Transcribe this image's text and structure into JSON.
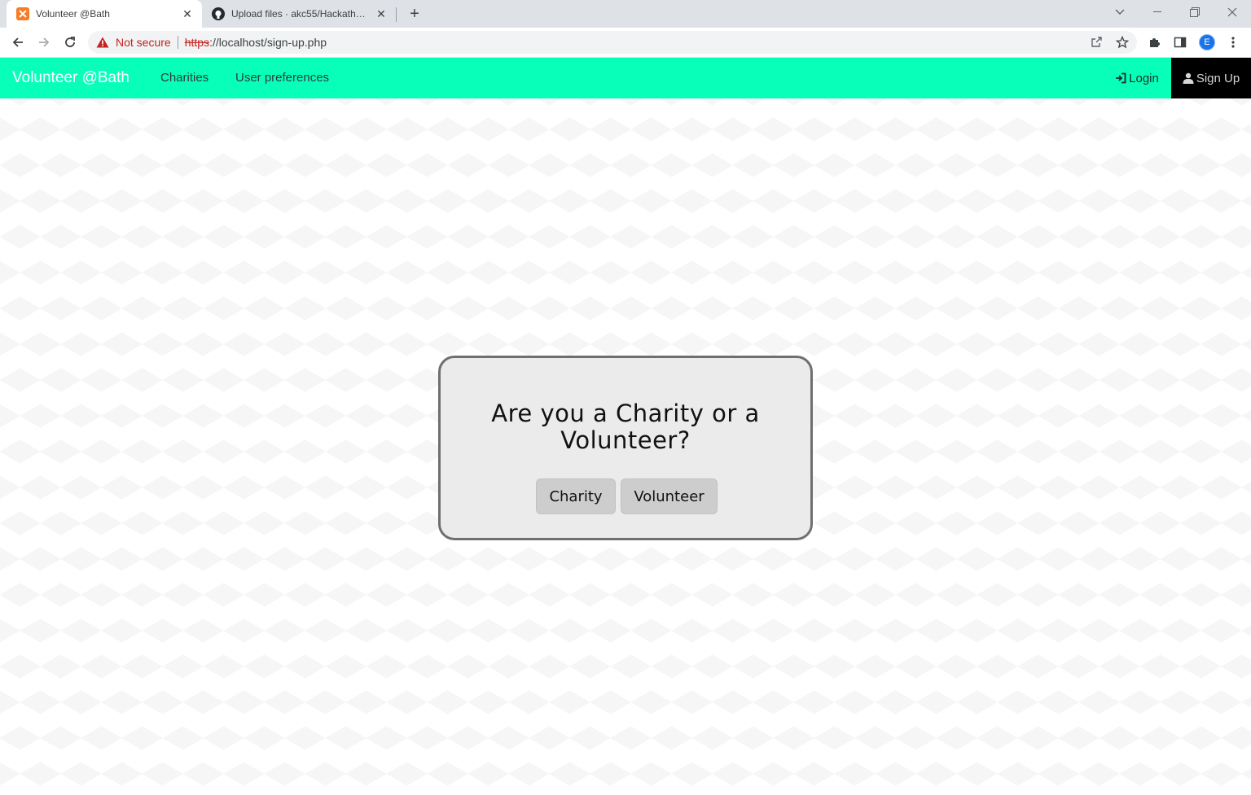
{
  "browser": {
    "tabs": [
      {
        "title": "Volunteer @Bath",
        "active": true,
        "favicon": "xampp-icon"
      },
      {
        "title": "Upload files · akc55/Hackathon-2",
        "active": false,
        "favicon": "github-icon"
      }
    ],
    "security_label": "Not secure",
    "url_scheme": "https",
    "url_rest": "://localhost/sign-up.php",
    "profile_initial": "E",
    "accent_color": "#1a73e8"
  },
  "navbar": {
    "brand": "Volunteer @Bath",
    "links": [
      "Charities",
      "User preferences"
    ],
    "login": "Login",
    "signup": "Sign Up",
    "background": "#07ffba"
  },
  "modal": {
    "question": "Are you a Charity or a Volunteer?",
    "buttons": [
      "Charity",
      "Volunteer"
    ]
  }
}
